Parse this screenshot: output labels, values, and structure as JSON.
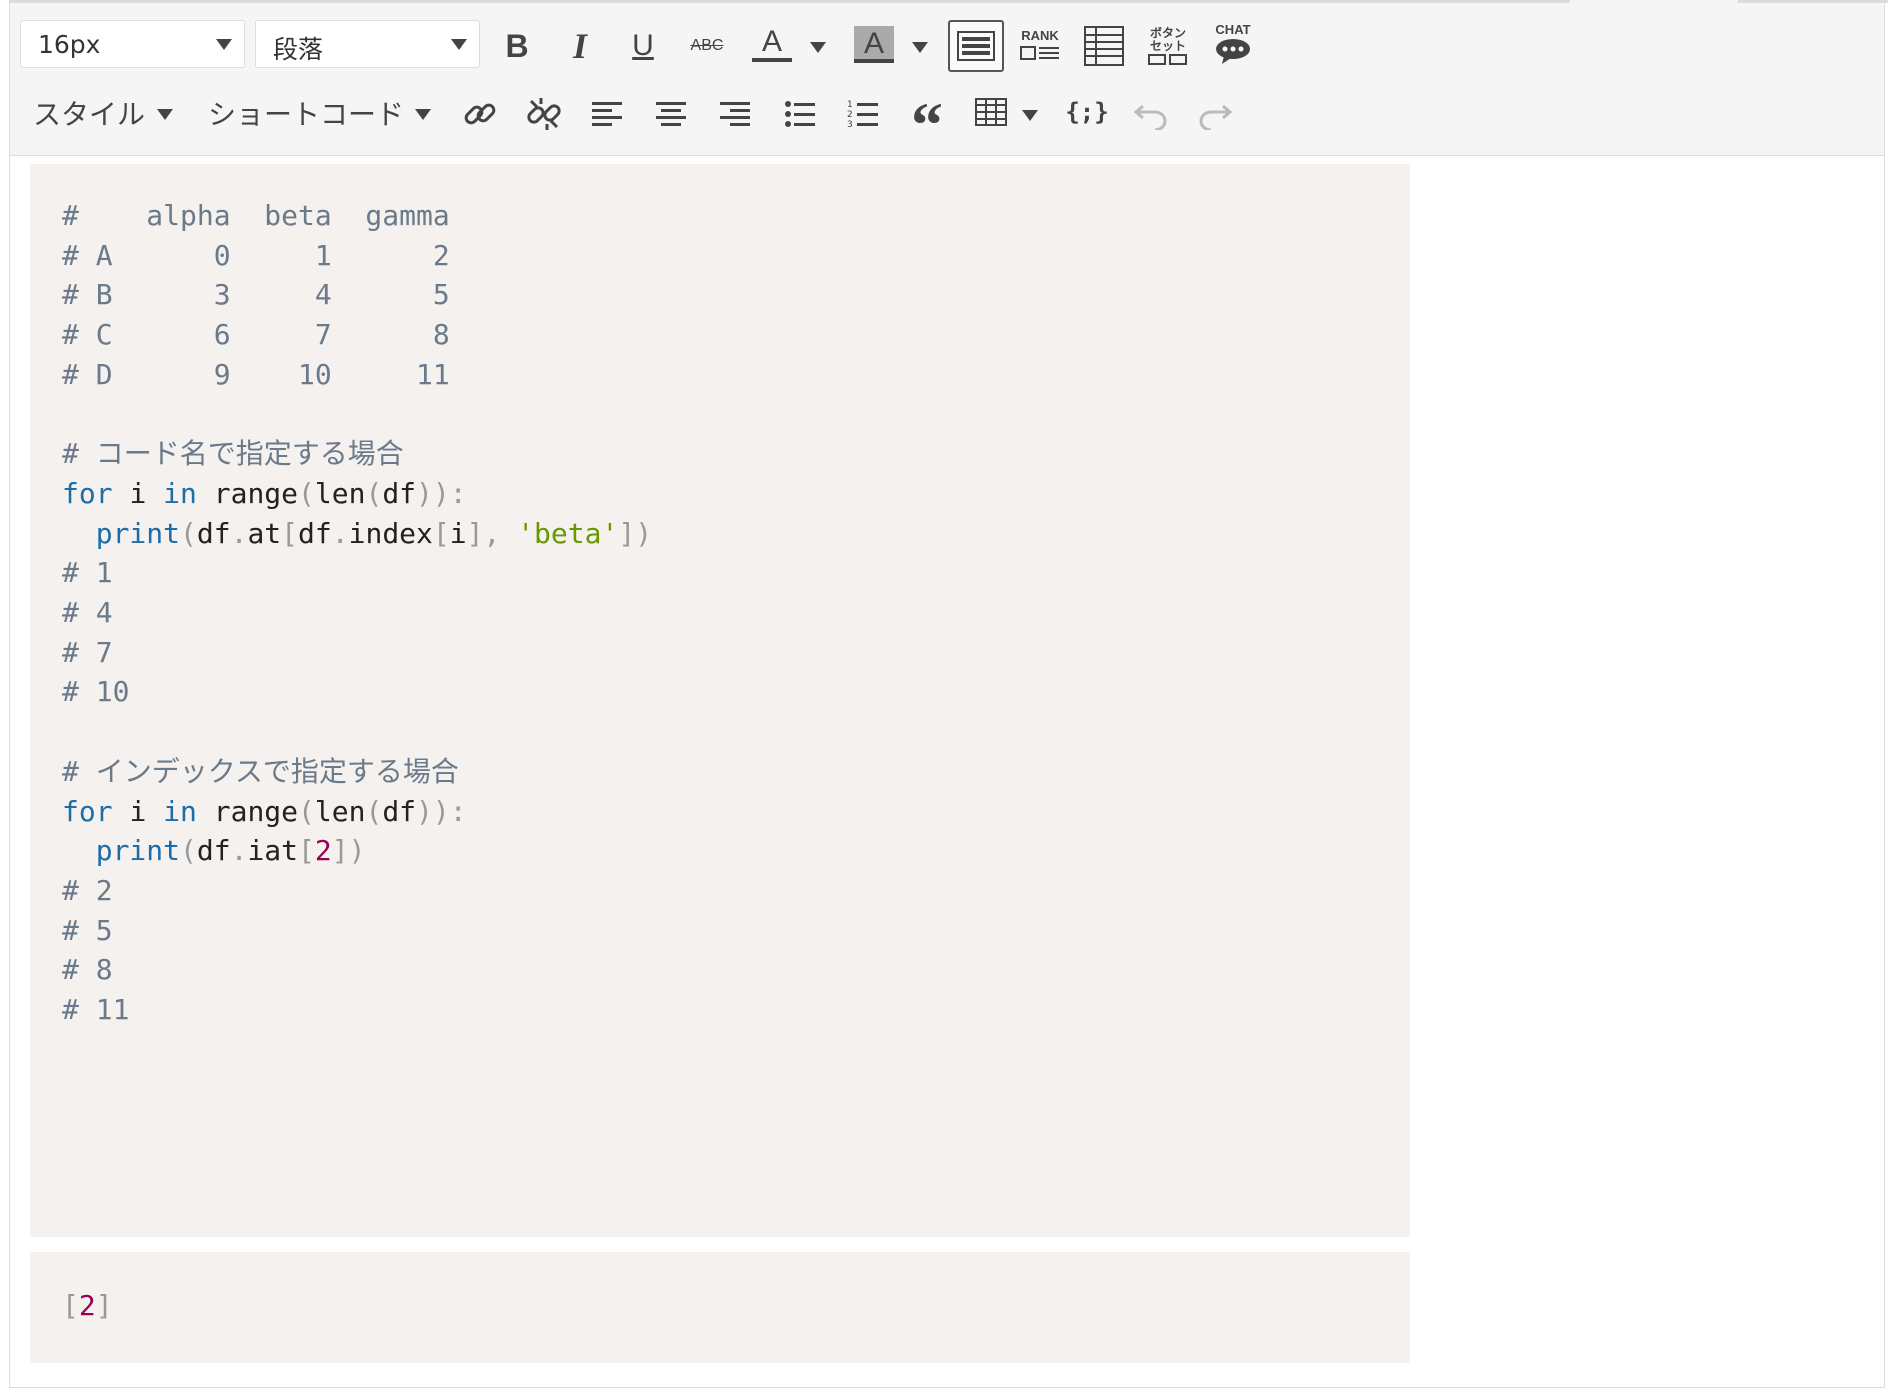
{
  "toolbar": {
    "font_size": "16px",
    "paragraph": "段落",
    "style_menu": "スタイル",
    "shortcode_menu": "ショートコード",
    "rank_label": "RANK",
    "button_set_label_1": "ボタン",
    "button_set_label_2": "セット",
    "chat_label": "CHAT",
    "text_color_glyph": "A",
    "bg_color_glyph": "A",
    "bold_glyph": "B",
    "italic_glyph": "I",
    "underline_glyph": "U",
    "strike_glyph": "ABC",
    "quote_glyph": "“",
    "code_glyph": "{;}"
  },
  "code_block_1": {
    "lines": [
      "#    alpha  beta  gamma",
      "# A      0     1      2",
      "# B      3     4      5",
      "# C      6     7      8",
      "# D      9    10     11",
      "",
      "# コード名で指定する場合",
      "for i in range(len(df)):",
      "  print(df.at[df.index[i], 'beta'])",
      "# 1",
      "# 4",
      "# 7",
      "# 10",
      "",
      "# インデックスで指定する場合",
      "for i in range(len(df)):",
      "  print(df.iat[2])",
      "# 2",
      "# 5",
      "# 8",
      "# 11"
    ]
  },
  "code_block_2": {
    "open": "[",
    "value": "2",
    "close": "]"
  },
  "colors": {
    "comment": "#6b7a8a",
    "keyword": "#1d6da8",
    "string": "#669900",
    "number": "#990055",
    "code_bg": "#f4f1ee",
    "toolbar_bg": "#f5f5f5"
  }
}
